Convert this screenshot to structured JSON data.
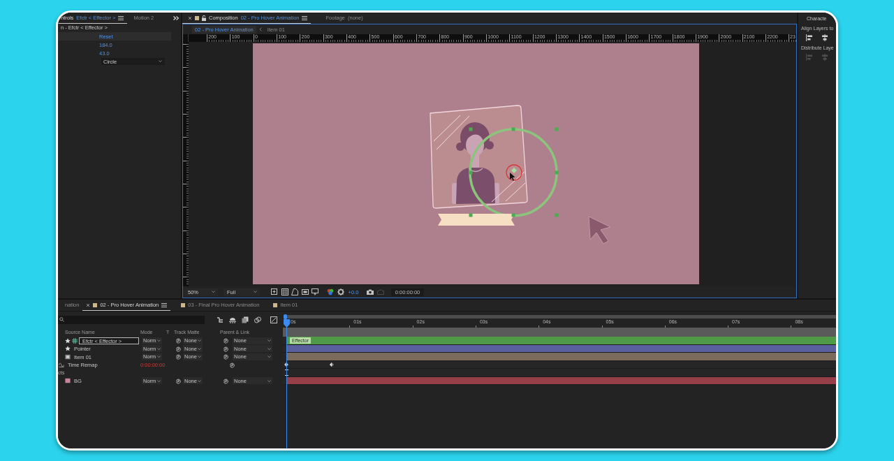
{
  "effect_controls": {
    "tabs": [
      {
        "label": "ntrols",
        "layer": "Efctr < Effector >",
        "selected": true
      },
      {
        "label": "Motion 2",
        "selected": false
      }
    ],
    "header": "n - Efctr < Effector >",
    "properties": [
      {
        "kind": "button",
        "value": "Reset"
      },
      {
        "kind": "number",
        "value": "184.0"
      },
      {
        "kind": "number",
        "value": "43.0"
      },
      {
        "kind": "dropdown",
        "value": "Circle"
      }
    ]
  },
  "composition": {
    "tabs": [
      {
        "kind": "composition",
        "label": "Composition",
        "name": "02 - Pro Hover Animation",
        "selected": true
      },
      {
        "kind": "footage",
        "label": "Footage",
        "name": "(none)",
        "selected": false
      }
    ],
    "breadcrumbs": [
      {
        "label": "02 - Pro Hover Animation",
        "selected": true
      },
      {
        "label": "Item 01",
        "selected": false
      }
    ],
    "ruler_labels": [
      "200",
      "100",
      "0",
      "100",
      "200",
      "300",
      "400",
      "500",
      "600",
      "700",
      "800",
      "900",
      "1000",
      "1100",
      "1200",
      "1300",
      "1400",
      "1500",
      "1600",
      "1700",
      "1800",
      "1900",
      "2000",
      "2100",
      "2200",
      "23"
    ],
    "toolbar": {
      "zoom": "50%",
      "resolution": "Full",
      "exposure": "+0.0",
      "timecode": "0:00:00:00"
    }
  },
  "align_panel": {
    "tab": "Characte",
    "sections": [
      {
        "title": "Align Layers to",
        "disabled": false
      },
      {
        "title": "Distribute Laye",
        "disabled": true
      }
    ]
  },
  "timeline": {
    "tabs": [
      {
        "kind": "cut",
        "label": "nation",
        "selected": false
      },
      {
        "kind": "composition",
        "label": "02 - Pro Hover Animation",
        "selected": true
      },
      {
        "kind": "composition",
        "label": "03 - Final Pro Hover Animation",
        "selected": false
      },
      {
        "kind": "composition",
        "label": "Item 01",
        "selected": false
      }
    ],
    "columns": [
      "Source Name",
      "Mode",
      "T",
      "Track Matte",
      "Parent & Link"
    ],
    "time_labels": [
      "0s",
      "01s",
      "02s",
      "03s",
      "04s",
      "05s",
      "06s",
      "07s",
      "08s"
    ],
    "rows": [
      {
        "kind": "effector_layer",
        "name": "Efctr < Effector >",
        "selected": true,
        "mode": "Norm",
        "track_matte": "None",
        "parent": "None",
        "color": "#4f9a47",
        "bar_label": "Effector"
      },
      {
        "kind": "shape_layer",
        "name": "Pointer",
        "selected": false,
        "mode": "Norm",
        "track_matte": "None",
        "parent": "None",
        "color": "#5a5f9e"
      },
      {
        "kind": "composition_layer",
        "name": "Item 01",
        "selected": false,
        "mode": "Norm",
        "track_matte": "None",
        "parent": "None",
        "color": "#7a6b5c"
      },
      {
        "kind": "property",
        "name": "Time Remap",
        "value": "0:00:00:00"
      },
      {
        "kind": "group",
        "name": "cts"
      },
      {
        "kind": "solid_layer",
        "name": "BG",
        "selected": false,
        "mode": "Norm",
        "track_matte": "None",
        "parent": "None",
        "color": "#973f49"
      }
    ]
  }
}
